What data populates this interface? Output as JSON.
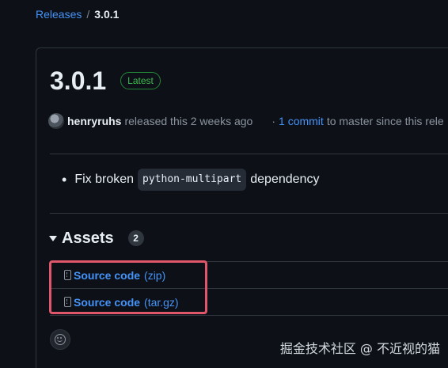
{
  "breadcrumb": {
    "parent": "Releases",
    "separator": "/",
    "current": "3.0.1"
  },
  "release": {
    "title": "3.0.1",
    "badge": "Latest",
    "author": "henryruhs",
    "released_text": "released this 2 weeks ago",
    "dot": "·",
    "commit_link": "1 commit",
    "since_text": "to master since this rele"
  },
  "notes": {
    "bullet": "•",
    "prefix": "Fix broken",
    "code": "python-multipart",
    "suffix": "dependency"
  },
  "assets": {
    "title": "Assets",
    "count": "2",
    "items": [
      {
        "name": "Source code",
        "ext": "(zip)"
      },
      {
        "name": "Source code",
        "ext": "(tar.gz)"
      }
    ]
  },
  "watermark": "掘金技术社区 @ 不近视的猫",
  "colors": {
    "background": "#0d1117",
    "link": "#4493f8",
    "badge_green": "#3fb950",
    "highlight": "#e0566a"
  }
}
